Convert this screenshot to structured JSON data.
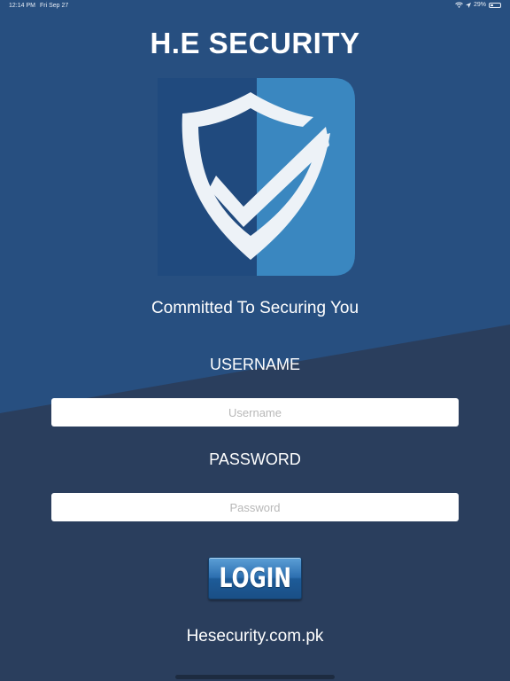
{
  "status_bar": {
    "time": "12:14 PM",
    "date": "Fri Sep 27",
    "battery": "29%",
    "battery_level": 0.29
  },
  "app": {
    "title": "H.E SECURITY",
    "tagline": "Committed To Securing You"
  },
  "logo": {
    "icon": "shield-check-icon",
    "colors": {
      "panel_dark": "#204a7e",
      "panel_light": "#3a87c0",
      "shield": "#edf2f7"
    }
  },
  "form": {
    "username_label": "USERNAME",
    "username_placeholder": "Username",
    "password_label": "PASSWORD",
    "password_placeholder": "Password",
    "login_label": "LOGIN"
  },
  "footer": {
    "website": "Hesecurity.com.pk"
  },
  "colors": {
    "background_top": "#274f80",
    "background_bottom": "#2a3e5d",
    "button": "#2d6fb0"
  }
}
